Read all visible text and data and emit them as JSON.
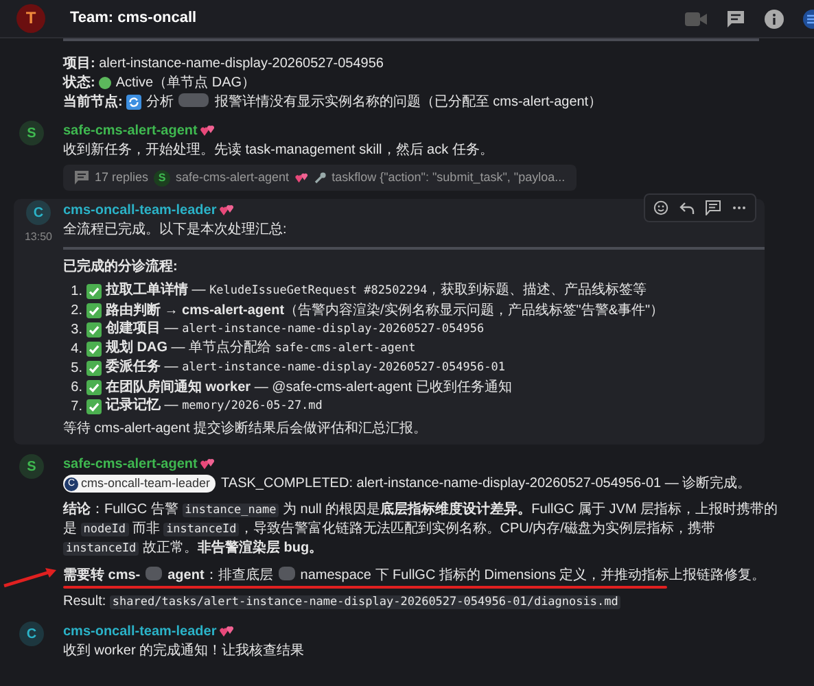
{
  "header": {
    "avatar": "T",
    "title": "Team: cms-oncall"
  },
  "messages": [
    {
      "lines": [
        {
          "parts": [
            {
              "kind": "rule"
            }
          ]
        },
        {
          "parts": [
            {
              "kind": "text",
              "segs": [
                {
                  "kind": "text",
                  "t": "**项目:** alert-instance-name-display-20260527-054956"
                }
              ]
            }
          ]
        },
        {
          "parts": [
            {
              "kind": "text",
              "segs": [
                {
                  "kind": "text",
                  "t": "**状态:**"
                }
              ]
            },
            {
              "kind": "status_dot"
            },
            {
              "kind": "text",
              "segs": [
                {
                  "kind": "text",
                  "t": "Active（单节点 DAG）"
                }
              ]
            }
          ]
        },
        {
          "parts": [
            {
              "kind": "text",
              "segs": [
                {
                  "kind": "text",
                  "t": "**当前节点:**"
                }
              ]
            },
            {
              "kind": "sync_icon"
            },
            {
              "kind": "text",
              "segs": [
                {
                  "kind": "text",
                  "t": "分析"
                },
                {
                  "kind": "redacted"
                },
                {
                  "kind": "text",
                  "t": "报警详情没有显示实例名称的问题（已分配至 cms-alert-agent）"
                }
              ]
            }
          ]
        }
      ]
    },
    {
      "avatar": "S",
      "author": "safe-cms-alert-agent",
      "color": "#3fb950",
      "lines": [
        {
          "parts": [
            {
              "kind": "text",
              "segs": [
                {
                  "kind": "text",
                  "t": "收到新任务，开始处理。先读 task-management skill，然后 ack 任务。"
                }
              ]
            }
          ]
        }
      ],
      "thread": {
        "replies": "17 replies",
        "avatar": "S",
        "author": "safe-cms-alert-agent",
        "preview": "taskflow {\"action\": \"submit_task\", \"payloa..."
      }
    },
    {
      "avatar": "C",
      "author": "cms-oncall-team-leader",
      "color": "#2bb3c8",
      "hovered": true,
      "time": "13:50",
      "lines": [
        {
          "parts": [
            {
              "kind": "text",
              "segs": [
                {
                  "kind": "text",
                  "t": "全流程已完成。以下是本次处理汇总:"
                }
              ]
            }
          ]
        },
        {
          "parts": [
            {
              "kind": "rule"
            }
          ]
        },
        {
          "parts": [
            {
              "kind": "text",
              "segs": [
                {
                  "kind": "text",
                  "t": "**已完成的分诊流程:**"
                }
              ]
            }
          ]
        }
      ],
      "list": [
        {
          "num": "1.",
          "segs": [
            {
              "kind": "text",
              "t": "**拉取工单详情** — "
            },
            {
              "kind": "code",
              "t": "KeludeIssueGetRequest #82502294"
            },
            {
              "kind": "text",
              "t": "，获取到标题、描述、产品线标签等"
            }
          ]
        },
        {
          "num": "2.",
          "segs": [
            {
              "kind": "text",
              "t": "**路由判断 → cms-alert-agent**（告警内容渲染/实例名称显示问题，产品线标签\"告警&事件\"）"
            }
          ]
        },
        {
          "num": "3.",
          "segs": [
            {
              "kind": "text",
              "t": "**创建项目** — "
            },
            {
              "kind": "code",
              "t": "alert-instance-name-display-20260527-054956"
            }
          ]
        },
        {
          "num": "4.",
          "segs": [
            {
              "kind": "text",
              "t": "**规划 DAG** — 单节点分配给 "
            },
            {
              "kind": "code",
              "t": "safe-cms-alert-agent"
            }
          ]
        },
        {
          "num": "5.",
          "segs": [
            {
              "kind": "text",
              "t": "**委派任务** — "
            },
            {
              "kind": "code",
              "t": "alert-instance-name-display-20260527-054956-01"
            }
          ]
        },
        {
          "num": "6.",
          "segs": [
            {
              "kind": "text",
              "t": "**在团队房间通知 worker** — @safe-cms-alert-agent 已收到任务通知"
            }
          ]
        },
        {
          "num": "7.",
          "segs": [
            {
              "kind": "text",
              "t": "**记录记忆** — "
            },
            {
              "kind": "code",
              "t": "memory/2026-05-27.md"
            }
          ]
        }
      ],
      "after": [
        {
          "parts": [
            {
              "kind": "text",
              "segs": [
                {
                  "kind": "text",
                  "t": "等待 cms-alert-agent 提交诊断结果后会做评估和汇总汇报。"
                }
              ]
            }
          ]
        }
      ]
    },
    {
      "avatar": "S",
      "author": "safe-cms-alert-agent",
      "color": "#3fb950",
      "lines": [
        {
          "parts": [
            {
              "kind": "mention",
              "avatar": "C",
              "name": "cms-oncall-team-leader"
            },
            {
              "kind": "text",
              "segs": [
                {
                  "kind": "text",
                  "t": "TASK_COMPLETED: alert-instance-name-display-20260527-054956-01 — 诊断完成。"
                }
              ]
            }
          ]
        },
        {
          "parts": [
            {
              "kind": "text",
              "segs": [
                {
                  "kind": "text",
                  "t": "**结论**：FullGC 告警 "
                },
                {
                  "kind": "code",
                  "t": "instance_name"
                },
                {
                  "kind": "text",
                  "t": " 为 null 的根因是**底层指标维度设计差异。**FullGC 属于 JVM 层指标，上报时携带的是 "
                },
                {
                  "kind": "code",
                  "t": "nodeId"
                },
                {
                  "kind": "text",
                  "t": " 而非 "
                },
                {
                  "kind": "code",
                  "t": "instanceId"
                },
                {
                  "kind": "text",
                  "t": "，导致告警富化链路无法匹配到实例名称。CPU/内存/磁盘为实例层指标，携带 "
                },
                {
                  "kind": "code",
                  "t": "instanceId"
                },
                {
                  "kind": "text",
                  "t": " 故正常。**非告警渲染层 bug。**"
                }
              ]
            }
          ]
        },
        {
          "annotated": true,
          "parts": [
            {
              "kind": "text",
              "segs": [
                {
                  "kind": "text",
                  "t": "**需要转 cms-**"
                },
                {
                  "kind": "redacted"
                },
                {
                  "kind": "text",
                  "t": "**agent**：排查底层"
                },
                {
                  "kind": "redacted"
                },
                {
                  "kind": "text",
                  "t": "namespace 下 FullGC 指标的 Dimensions 定义，并推动指标上报链路修复。"
                }
              ]
            }
          ]
        },
        {
          "parts": [
            {
              "kind": "text",
              "segs": [
                {
                  "kind": "text",
                  "t": "Result: "
                },
                {
                  "kind": "code",
                  "t": "shared/tasks/alert-instance-name-display-20260527-054956-01/diagnosis.md"
                }
              ]
            }
          ]
        }
      ]
    },
    {
      "avatar": "C",
      "author": "cms-oncall-team-leader",
      "color": "#2bb3c8",
      "lines": [
        {
          "parts": [
            {
              "kind": "text",
              "segs": [
                {
                  "kind": "text",
                  "t": "收到 worker 的完成通知！让我核查结果"
                }
              ]
            }
          ]
        }
      ]
    }
  ]
}
